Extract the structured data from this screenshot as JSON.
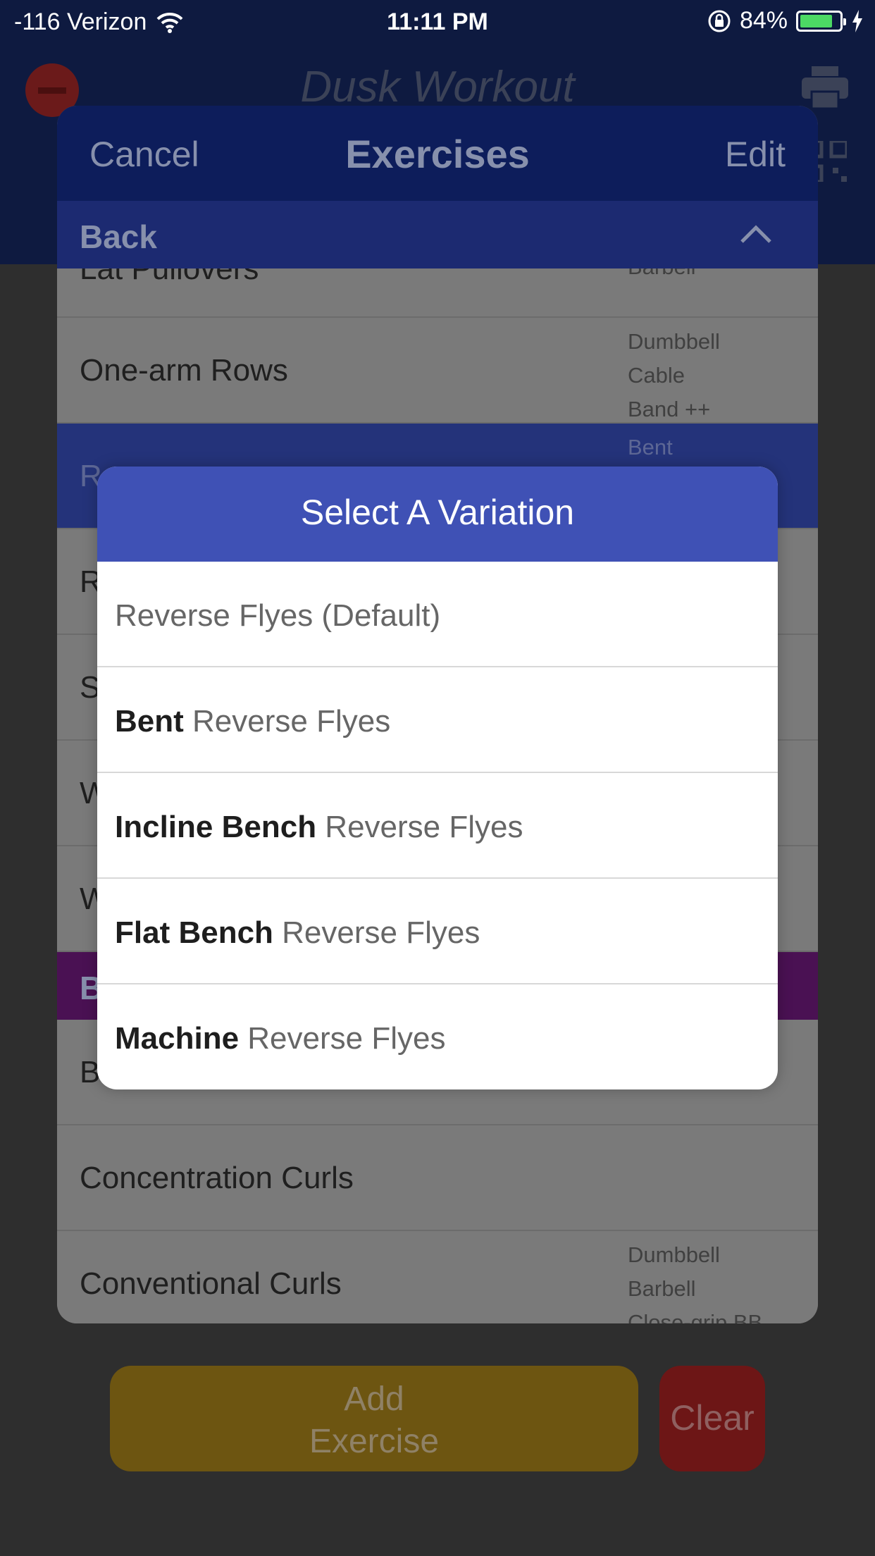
{
  "status_bar": {
    "carrier": "-116 Verizon",
    "time": "11:11 PM",
    "battery_percent": "84%"
  },
  "app": {
    "workout_title": "Dusk Workout"
  },
  "sheet": {
    "cancel_label": "Cancel",
    "title": "Exercises",
    "edit_label": "Edit",
    "section_back": "Back",
    "section_biceps": "Bi",
    "partial_row": {
      "name": "Lat Pullovers",
      "equip": "Barbell"
    },
    "back_rows": [
      {
        "name": "One-arm Rows",
        "equip": [
          "Dumbbell",
          "Cable",
          "Band ++"
        ]
      },
      {
        "name": "Re",
        "equip": [
          "Bent",
          ""
        ]
      },
      {
        "name": "R",
        "equip": []
      },
      {
        "name": "S",
        "equip": []
      },
      {
        "name": "W",
        "equip": []
      },
      {
        "name": "W",
        "equip": []
      }
    ],
    "biceps_rows": [
      {
        "name": "B",
        "equip": []
      },
      {
        "name": "Concentration Curls",
        "equip": []
      },
      {
        "name": "Conventional Curls",
        "equip": [
          "Dumbbell",
          "Barbell",
          "Close-grip BB"
        ]
      }
    ]
  },
  "buttons": {
    "add_line1": "Add",
    "add_line2": "Exercise",
    "clear": "Clear"
  },
  "modal": {
    "title": "Select A Variation",
    "options": [
      {
        "bold": "",
        "rest": "Reverse Flyes (Default)"
      },
      {
        "bold": "Bent",
        "rest": " Reverse Flyes"
      },
      {
        "bold": "Incline Bench",
        "rest": " Reverse Flyes"
      },
      {
        "bold": "Flat Bench",
        "rest": " Reverse Flyes"
      },
      {
        "bold": "Machine",
        "rest": " Reverse Flyes"
      }
    ]
  },
  "colors": {
    "modal_header": "#3f51b5",
    "battery_fill": "#4cd964",
    "add_button": "#6d5511",
    "clear_button": "#6d1616"
  }
}
